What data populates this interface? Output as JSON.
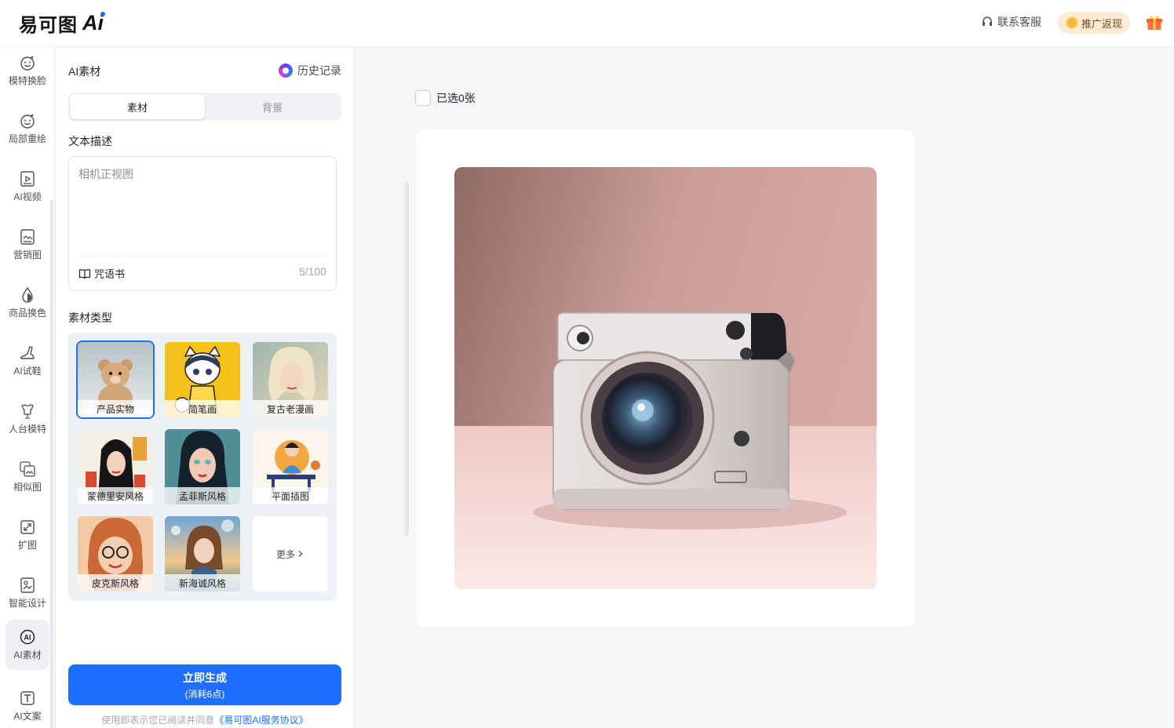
{
  "header": {
    "logo_text": "易可图",
    "logo_ai": "Ai",
    "contact_label": "联系客服",
    "promo_label": "推广返现",
    "icons": [
      "headset-icon",
      "coin-icon",
      "gift-icon"
    ]
  },
  "nav": {
    "items": [
      {
        "label": "模特换脸",
        "icon": "face-swap-icon"
      },
      {
        "label": "局部重绘",
        "icon": "partial-redraw-icon"
      },
      {
        "label": "AI视频",
        "icon": "video-icon"
      },
      {
        "label": "营销图",
        "icon": "marketing-image-icon"
      },
      {
        "label": "商品换色",
        "icon": "color-drop-icon"
      },
      {
        "label": "AI试鞋",
        "icon": "shoe-icon"
      },
      {
        "label": "人台模特",
        "icon": "mannequin-icon"
      },
      {
        "label": "相似图",
        "icon": "similar-image-icon"
      },
      {
        "label": "扩图",
        "icon": "expand-image-icon"
      },
      {
        "label": "智能设计",
        "icon": "smart-design-icon"
      },
      {
        "label": "AI素材",
        "icon": "ai-badge-icon",
        "active": true
      },
      {
        "label": "AI文案",
        "icon": "text-t-icon"
      }
    ]
  },
  "panel": {
    "title": "AI素材",
    "history_label": "历史记录",
    "tabs": [
      {
        "label": "素材",
        "active": true
      },
      {
        "label": "背景",
        "active": false
      }
    ],
    "description_label": "文本描述",
    "description_value": "相机正视图",
    "spellbook_label": "咒语书",
    "counter": "5/100",
    "type_label": "素材类型",
    "types": [
      {
        "label": "产品实物",
        "selected": true
      },
      {
        "label": "简笔画"
      },
      {
        "label": "复古老漫画"
      },
      {
        "label": "蒙德里安风格"
      },
      {
        "label": "孟菲斯风格"
      },
      {
        "label": "平面插图"
      },
      {
        "label": "皮克斯风格"
      },
      {
        "label": "新海诚风格"
      }
    ],
    "more_label": "更多",
    "generate_label": "立即生成",
    "generate_cost": "(消耗6点)",
    "agreement_prefix": "使用即表示您已阅读并同意",
    "agreement_link": "《易可图AI服务协议》"
  },
  "main": {
    "selected_label": "已选0张",
    "checked": false
  },
  "colors": {
    "accent": "#1e6fff",
    "promo_bg": "#fdebd5"
  }
}
